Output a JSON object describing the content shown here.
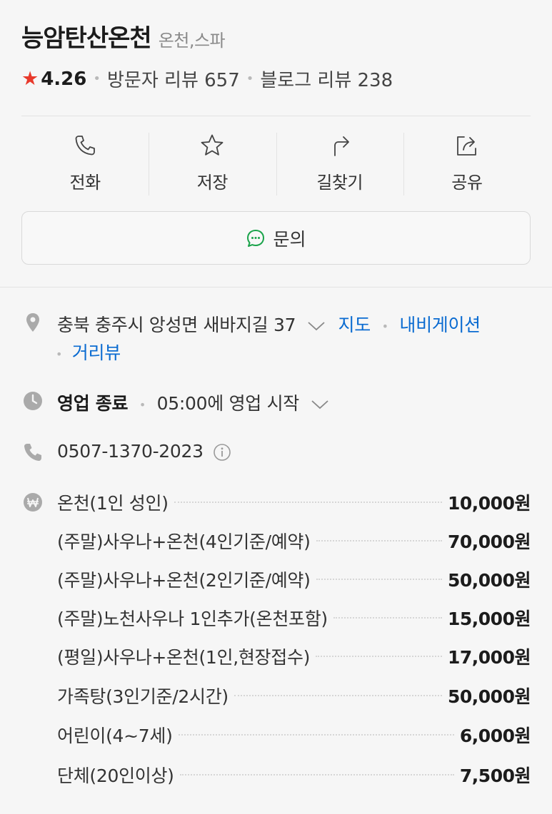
{
  "header": {
    "name": "능암탄산온천",
    "category": "온천,스파",
    "rating": "4.26",
    "visitor_reviews": "방문자 리뷰 657",
    "blog_reviews": "블로그 리뷰 238"
  },
  "actions": [
    {
      "label": "전화",
      "icon": "phone-icon"
    },
    {
      "label": "저장",
      "icon": "star-outline-icon"
    },
    {
      "label": "길찾기",
      "icon": "directions-arrow-icon"
    },
    {
      "label": "공유",
      "icon": "share-icon"
    }
  ],
  "inquiry": {
    "label": "문의",
    "icon": "chat-bubble-icon"
  },
  "address": {
    "text": "충북 충주시 앙성면 새바지길 37",
    "map_link": "지도",
    "navigation_link": "내비게이션",
    "street_view_link": "거리뷰"
  },
  "hours": {
    "status": "영업 종료",
    "next": "05:00에 영업 시작"
  },
  "phone": {
    "number": "0507-1370-2023"
  },
  "prices": [
    {
      "name": "온천(1인 성인)",
      "price": "10,000",
      "unit": "원"
    },
    {
      "name": "(주말)사우나+온천(4인기준/예약)",
      "price": "70,000",
      "unit": "원"
    },
    {
      "name": "(주말)사우나+온천(2인기준/예약)",
      "price": "50,000",
      "unit": "원"
    },
    {
      "name": "(주말)노천사우나 1인추가(온천포함)",
      "price": "15,000",
      "unit": "원"
    },
    {
      "name": "(평일)사우나+온천(1인,현장접수)",
      "price": "17,000",
      "unit": "원"
    },
    {
      "name": "가족탕(3인기준/2시간)",
      "price": "50,000",
      "unit": "원"
    },
    {
      "name": "어린이(4~7세)",
      "price": "6,000",
      "unit": "원"
    },
    {
      "name": "단체(20인이상)",
      "price": "7,500",
      "unit": "원"
    }
  ],
  "colors": {
    "star": "#e8392b",
    "link": "#0a6bd1",
    "chat_icon": "#1aa34a"
  }
}
